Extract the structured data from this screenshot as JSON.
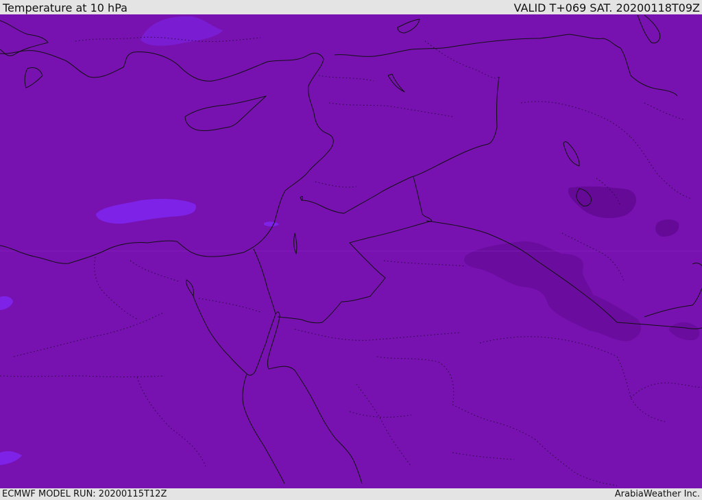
{
  "header": {
    "title": "Temperature at 10 hPa",
    "valid": "VALID T+069 SAT. 20200118T09Z"
  },
  "footer": {
    "model_run": "ECMWF MODEL RUN: 20200115T12Z",
    "credit": "ArabiaWeather Inc."
  },
  "map": {
    "fill_colors": {
      "base": "#7711b0",
      "cooler": "#6e0ea6",
      "coldest": "#640a96",
      "warmer": "#7a1cd2",
      "warmest": "#7d22e6"
    },
    "line_colors": {
      "coast": "#111111",
      "border": "#111111",
      "admin": "#2a0a40"
    }
  }
}
